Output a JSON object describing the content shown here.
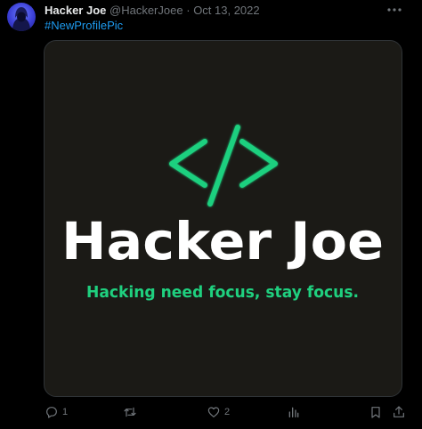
{
  "tweet": {
    "author_name": "Hacker Joe",
    "author_handle": "@HackerJoee",
    "separator": "·",
    "date": "Oct 13, 2022",
    "text": "#NewProfilePic",
    "media": {
      "logo_symbol": "</>",
      "title": "Hacker Joe",
      "tagline": "Hacking need focus, stay focus.",
      "colors": {
        "background": "#1b1a16",
        "accent": "#1fd07f",
        "title": "#ffffff"
      }
    },
    "actions": {
      "reply_icon": "reply-icon",
      "reply_count": "1",
      "retweet_icon": "retweet-icon",
      "like_icon": "heart-icon",
      "like_count": "2",
      "views_icon": "views-icon",
      "bookmark_icon": "bookmark-icon",
      "share_icon": "share-icon"
    }
  },
  "colors": {
    "background": "#000000",
    "text": "#e7e9ea",
    "muted": "#71767b",
    "link": "#1d9bf0",
    "border": "#2f3336"
  }
}
